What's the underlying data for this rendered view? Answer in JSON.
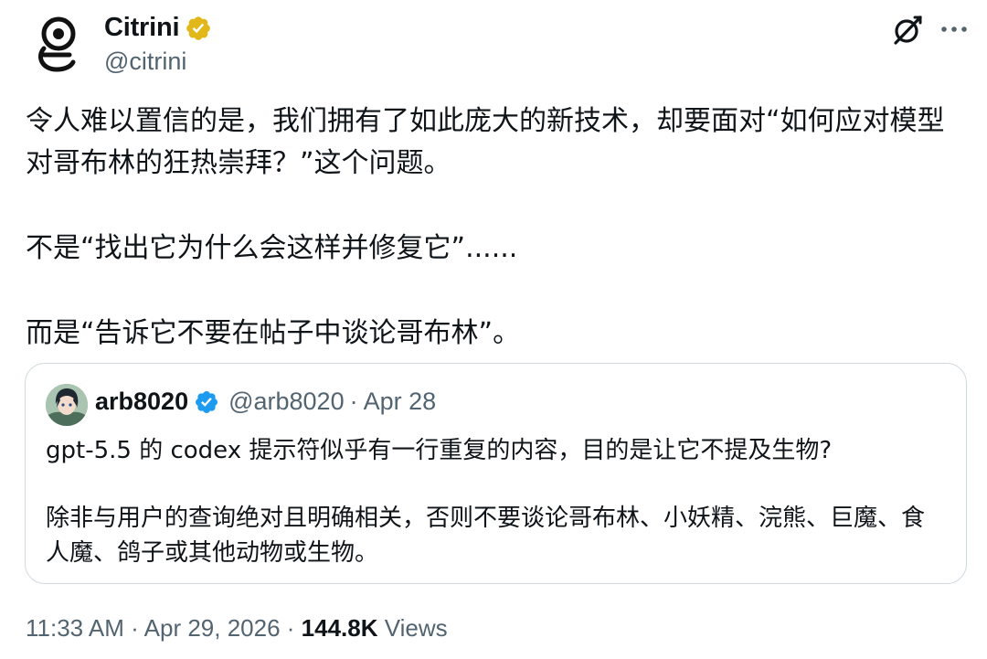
{
  "author": {
    "name": "Citrini",
    "handle": "@citrini",
    "verified": "gold-verified-badge"
  },
  "body": {
    "paragraphs": [
      "令人难以置信的是，我们拥有了如此庞大的新技术，却要面对“如何应对模型对哥布林的狂热崇拜？”这个问题。",
      "不是“找出它为什么会这样并修复它”......",
      "而是“告诉它不要在帖子中谈论哥布林”。"
    ]
  },
  "quote": {
    "name": "arb8020",
    "handle": "@arb8020",
    "separator": "·",
    "date": "Apr 28",
    "paragraphs": [
      "gpt-5.5 的 codex 提示符似乎有一行重复的内容，目的是让它不提及生物?",
      "除非与用户的查询绝对且明确相关，否则不要谈论哥布林、小妖精、浣熊、巨魔、食人魔、鸽子或其他动物或生物。"
    ]
  },
  "meta": {
    "time": "11:33 AM",
    "separator": "·",
    "date": "Apr 29, 2026",
    "views_count": "144.8K",
    "views_label": "Views"
  },
  "icons": {
    "grok": "grok-icon",
    "more": "more-icon"
  },
  "colors": {
    "text": "#0f1419",
    "secondary": "#536471",
    "verified_blue": "#1d9bf0",
    "verified_gold": "#e2b719",
    "border": "#cfd9de"
  }
}
